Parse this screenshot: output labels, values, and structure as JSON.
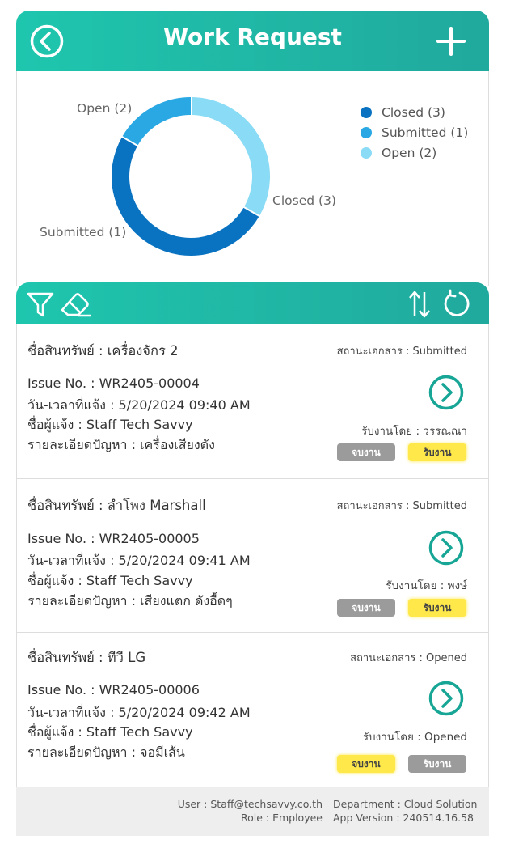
{
  "header": {
    "title": "Work Request",
    "back_icon": "back-circle-icon",
    "add_icon": "plus-icon",
    "color_start": "#1fc6ae",
    "color_end": "#20a99d"
  },
  "chart_data": {
    "type": "pie",
    "donut": true,
    "categories": [
      "Closed",
      "Submitted",
      "Open"
    ],
    "values": [
      3,
      1,
      2
    ],
    "colors": [
      "#0a73c1",
      "#29a8e3",
      "#8adbf5"
    ],
    "slice_labels": [
      "Closed (3)",
      "Submitted (1)",
      "Open (2)"
    ],
    "legend": [
      "Closed (3)",
      "Submitted (1)",
      "Open (2)"
    ],
    "legend_position": "right"
  },
  "toolbar": {
    "filter_icon": "filter-icon",
    "clear_icon": "eraser-icon",
    "sort_icon": "sort-icon",
    "refresh_icon": "refresh-icon"
  },
  "items": [
    {
      "asset": "ชื่อสินทรัพย์ : เครื่องจักร 2",
      "status": "สถานะเอกสาร : Submitted",
      "issue": "Issue No. : WR2405-00004",
      "datetime": "วัน-เวลาที่แจ้ง : 5/20/2024  09:40 AM",
      "reporter": "ชื่อผู้แจ้ง : Staff Tech Savvy",
      "problem": "รายละเอียดปัญหา : เครื่องเสียงดัง",
      "accepted_by": "รับงานโดย : วรรณณา",
      "finish_label": "จบงาน",
      "accept_label": "รับงาน"
    },
    {
      "asset": "ชื่อสินทรัพย์ : ลำโพง Marshall",
      "status": "สถานะเอกสาร : Submitted",
      "issue": "Issue No. : WR2405-00005",
      "datetime": "วัน-เวลาที่แจ้ง : 5/20/2024  09:41 AM",
      "reporter": "ชื่อผู้แจ้ง : Staff Tech Savvy",
      "problem": "รายละเอียดปัญหา : เสียงแตก ดังอื้ดๆ",
      "accepted_by": "รับงานโดย : พงษ์",
      "finish_label": "จบงาน",
      "accept_label": "รับงาน"
    },
    {
      "asset": "ชื่อสินทรัพย์ : ทีวี LG",
      "status": "สถานะเอกสาร : Opened",
      "issue": "Issue No. : WR2405-00006",
      "datetime": "วัน-เวลาที่แจ้ง : 5/20/2024  09:42 AM",
      "reporter": "ชื่อผู้แจ้ง : Staff Tech Savvy",
      "problem": "รายละเอียดปัญหา : จอมีเส้น",
      "accepted_by": "รับงานโดย : Opened",
      "finish_label": "จบงาน",
      "accept_label": "รับงาน"
    }
  ],
  "footer": {
    "user": "User : Staff@techsavvy.co.th",
    "role": "Role : Employee",
    "department": "Department : Cloud Solution",
    "app_version": "App Version : 240514.16.58"
  }
}
